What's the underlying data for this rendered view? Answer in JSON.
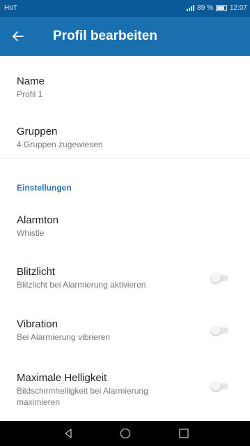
{
  "status_bar": {
    "carrier": "HoT",
    "battery": "89 %",
    "time": "12:07"
  },
  "app_bar": {
    "title": "Profil bearbeiten",
    "back_icon": "arrow-left-icon"
  },
  "profile": {
    "name_label": "Name",
    "name_value": "Profil 1",
    "groups_label": "Gruppen",
    "groups_value": "4 Gruppen zugewiesen"
  },
  "settings": {
    "section_title": "Einstellungen",
    "items": [
      {
        "label": "Alarmton",
        "sub": "Whistle"
      },
      {
        "label": "Blitzlicht",
        "sub": "Blitzlicht bei Alarmierung aktivieren",
        "toggle_on": false
      },
      {
        "label": "Vibration",
        "sub": "Bei Alarmierung vibrieren",
        "toggle_on": false
      },
      {
        "label": "Maximale Helligkeit",
        "sub": "Bildschirmhelligkeit bei Alarmierung maximieren",
        "toggle_on": false
      }
    ]
  },
  "nav_bar": {
    "icons": [
      "back-triangle-icon",
      "home-circle-icon",
      "recents-square-icon"
    ]
  },
  "colors": {
    "app_bar": "#1a6fb0",
    "status_bar": "#0a5a9a",
    "accent": "#2a74b5"
  }
}
